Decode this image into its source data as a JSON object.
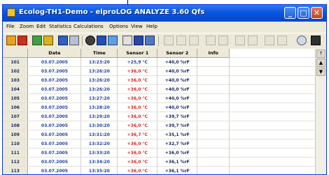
{
  "window": {
    "title": "Ecolog-TH1-Demo - elproLOG ANALYZE 3.60 Qfs"
  },
  "titlebar_buttons": [
    {
      "name": "minimize-button",
      "glyph": "_"
    },
    {
      "name": "maximize-button",
      "glyph": "□"
    },
    {
      "name": "close-button",
      "glyph": "✕"
    }
  ],
  "menu": [
    "File",
    "Zoom",
    "Edit",
    "Statistics",
    "Calculations",
    "Options",
    "View",
    "Help"
  ],
  "toolbar": {
    "enabled_icons": [
      "logger-icon",
      "download-icon",
      "save-icon",
      "export-icon",
      "open-icon",
      "print-icon",
      "copy-icon",
      "chart-icon",
      "table-icon",
      "list-icon",
      "report-icon"
    ],
    "disabled_icons": [
      "disabled-tool-1",
      "disabled-tool-2",
      "disabled-tool-3",
      "disabled-tool-4",
      "disabled-tool-5",
      "disabled-tool-6",
      "disabled-tool-7"
    ],
    "right_icons": [
      "info-icon",
      "grid-icon"
    ]
  },
  "table": {
    "headers": [
      "",
      "Date",
      "Time",
      "Sensor 1",
      "Sensor 2",
      "Info"
    ],
    "rows": [
      {
        "no": "101",
        "date": "03.07.2005",
        "time": "13:23:20",
        "s1": "+25,9 °C",
        "s2": "+40,0 %rF"
      },
      {
        "no": "102",
        "date": "03.07.2005",
        "time": "13:26:20",
        "s1": "+36,0 °C",
        "s2": "+40,0 %rF"
      },
      {
        "no": "103",
        "date": "03.07.2005",
        "time": "13:26:20",
        "s1": "+36,0 °C",
        "s2": "+40,0 %rF"
      },
      {
        "no": "104",
        "date": "03.07.2005",
        "time": "13:26:20",
        "s1": "+36,0 °C",
        "s2": "+40,0 %rF"
      },
      {
        "no": "105",
        "date": "03.07.2005",
        "time": "13:27:20",
        "s1": "+36,0 °C",
        "s2": "+40,0 %rF"
      },
      {
        "no": "106",
        "date": "03.07.2005",
        "time": "13:28:20",
        "s1": "+36,0 °C",
        "s2": "+40,0 %rF"
      },
      {
        "no": "107",
        "date": "03.07.2005",
        "time": "13:29:20",
        "s1": "+36,0 °C",
        "s2": "+39,7 %rF"
      },
      {
        "no": "108",
        "date": "03.07.2005",
        "time": "13:30:20",
        "s1": "+36,0 °C",
        "s2": "+39,7 %rF"
      },
      {
        "no": "109",
        "date": "03.07.2005",
        "time": "13:31:20",
        "s1": "+36,7 °C",
        "s2": "+35,1 %rF"
      },
      {
        "no": "110",
        "date": "03.07.2005",
        "time": "13:32:20",
        "s1": "+36,0 °C",
        "s2": "+32,7 %rF"
      },
      {
        "no": "111",
        "date": "03.07.2005",
        "time": "13:33:20",
        "s1": "+36,0 °C",
        "s2": "+36,0 %rF"
      },
      {
        "no": "112",
        "date": "03.07.2005",
        "time": "13:34:20",
        "s1": "+36,0 °C",
        "s2": "+36,1 %rF"
      },
      {
        "no": "113",
        "date": "03.07.2005",
        "time": "13:35:20",
        "s1": "+36,0 °C",
        "s2": "+36,1 %rF"
      }
    ]
  },
  "colors": {
    "titlebar": "#0a55e0",
    "date_text": "#2040a0",
    "sensor1_text": "#e02020",
    "sensor2_text": "#13205e",
    "first_sensor1_text": "#2040a0"
  }
}
